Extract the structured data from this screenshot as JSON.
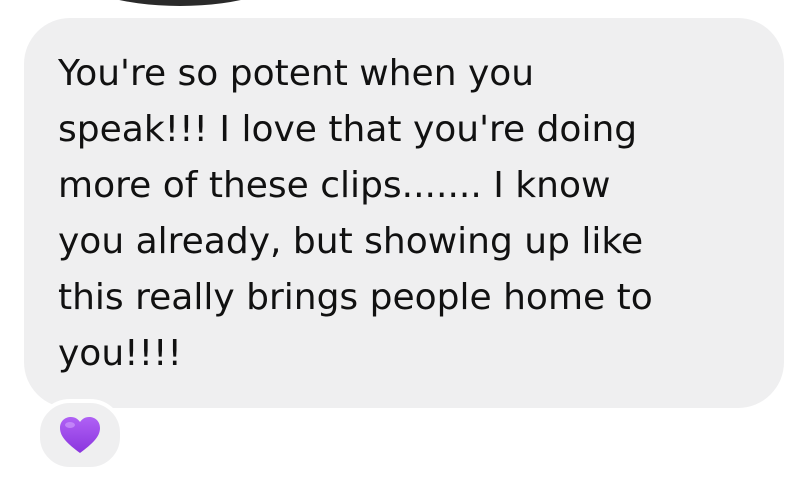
{
  "message": {
    "text": "You're so potent when you\nspeak!!! I love that you're doing\nmore of these clips....... I know\nyou already, but showing up like\nthis really brings people home to\nyou!!!!"
  },
  "reaction": {
    "icon": "purple-heart-icon",
    "color": "#9b44e8"
  },
  "colors": {
    "bubble": "#efeff0",
    "text": "#111111",
    "background": "#ffffff"
  }
}
